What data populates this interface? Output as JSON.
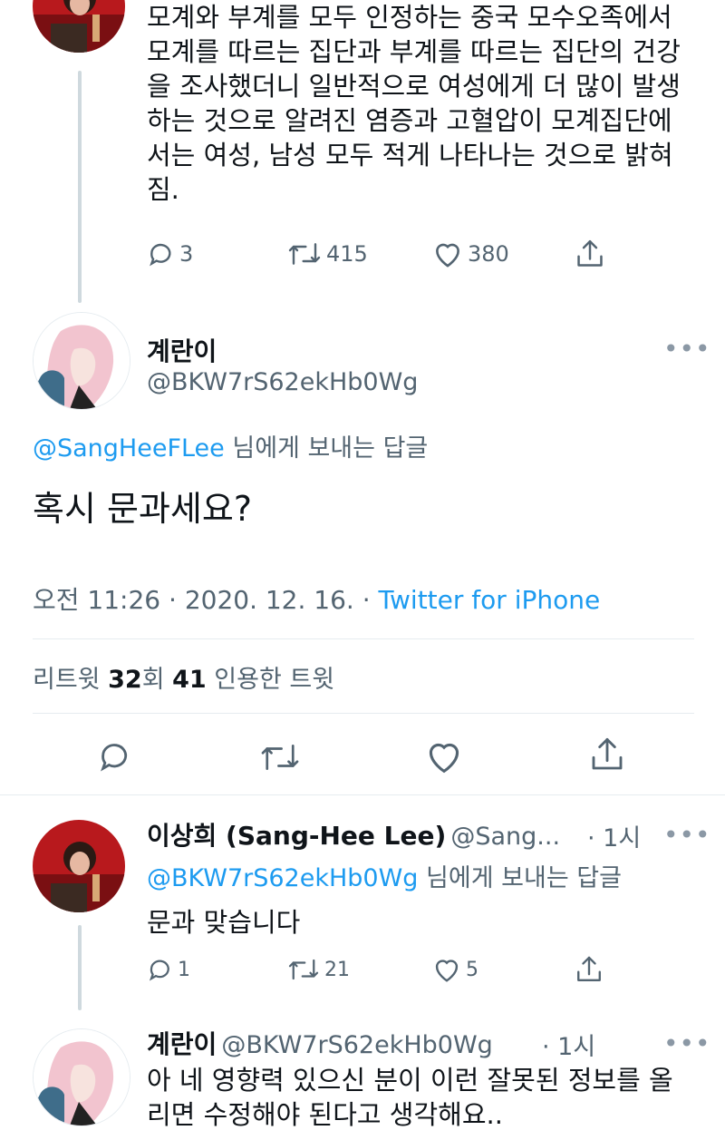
{
  "tweet1": {
    "lines": [
      "모계와 부계를 모두 인정하는 중국 모수오족에서",
      "모계를 따르는 집단과 부계를 따르는 집단의 건강",
      "을 조사했더니 일반적으로 여성에게 더 많이 발생",
      "하는 것으로 알려진 염증과 고혈압이 모계집단에",
      "서는 여성, 남성 모두 적게 나타나는 것으로 밝혀",
      "짐."
    ],
    "replies": "3",
    "retweets": "415",
    "likes": "380"
  },
  "focus": {
    "name": "계란이",
    "handle": "@BKW7rS62ekHb0Wg",
    "more": "•••",
    "reply_to_handle": "@SangHeeFLee",
    "reply_to_suffix": " 님에게 보내는 답글",
    "text": "혹시 문과세요?",
    "time": "오전 11:26 · 2020. 12. 16. · ",
    "source": "Twitter for iPhone",
    "stats": {
      "rt_label": "리트윗 ",
      "rt_count": "32",
      "rt_suffix": "회  ",
      "quote_count": "41",
      "quote_label": " 인용한 트윗"
    }
  },
  "reply1": {
    "name": "이상희 (Sang-Hee Lee)",
    "handle": "@Sang...",
    "time": "· 1시",
    "more": "•••",
    "reply_to_handle": "@BKW7rS62ekHb0Wg",
    "reply_to_suffix": " 님에게 보내는 답글",
    "text": "문과 맞습니다",
    "replies": "1",
    "retweets": "21",
    "likes": "5"
  },
  "reply2": {
    "name": "계란이",
    "handle": "@BKW7rS62ekHb0Wg",
    "time": "· 1시",
    "more": "•••",
    "lines": [
      "아 네 영향력 있으신 분이 이런 잘못된 정보를 올",
      "리면 수정해야 된다고 생각해요.."
    ]
  },
  "colors": {
    "accent": "#1d9bf0",
    "text": "#0f1419",
    "muted": "#536471",
    "line": "#cfd9de"
  }
}
